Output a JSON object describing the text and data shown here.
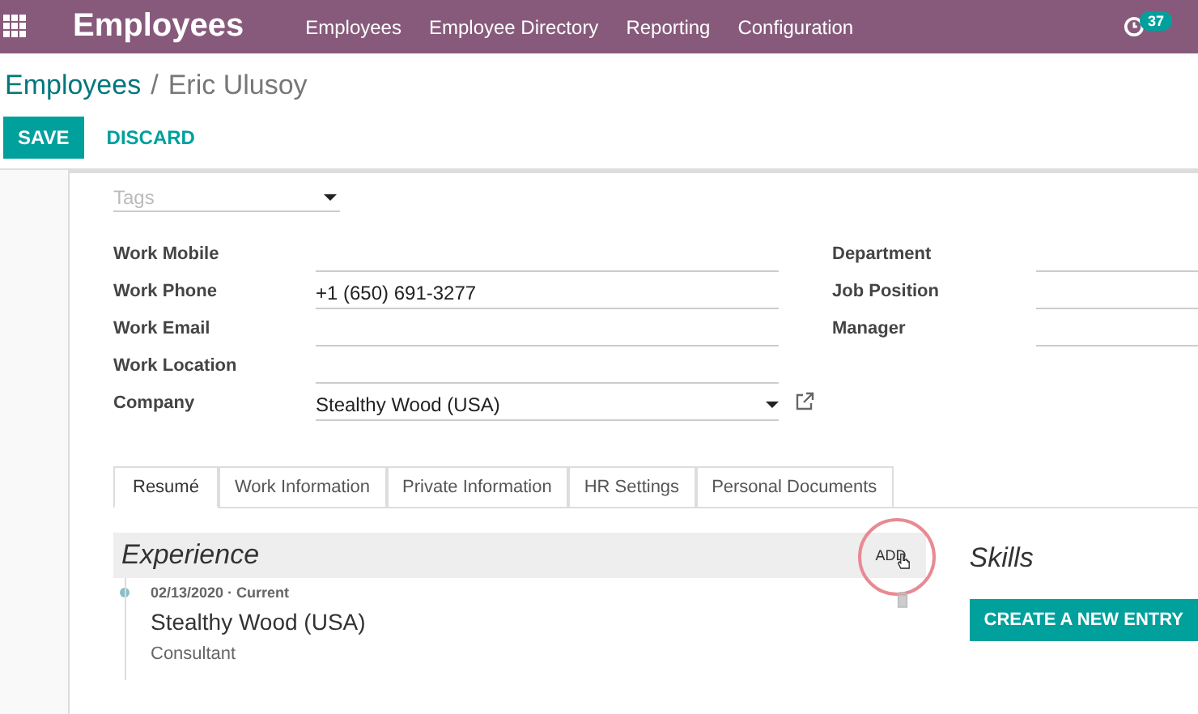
{
  "navbar": {
    "app_title": "Employees",
    "menu": [
      "Employees",
      "Employee Directory",
      "Reporting",
      "Configuration"
    ],
    "activity_count": "37"
  },
  "breadcrumb": {
    "parent": "Employees",
    "separator": "/",
    "current": "Eric Ulusoy"
  },
  "actions": {
    "save": "SAVE",
    "discard": "DISCARD"
  },
  "tags_field": {
    "placeholder": "Tags"
  },
  "left_fields": [
    {
      "label": "Work Mobile",
      "kind": "text"
    },
    {
      "label": "Work Phone",
      "kind": "text",
      "value": "+1 (650) 691-3277"
    },
    {
      "label": "Work Email",
      "kind": "text"
    },
    {
      "label": "Work Location",
      "kind": "text"
    },
    {
      "label": "Company",
      "kind": "select",
      "value": "Stealthy Wood (USA)"
    }
  ],
  "right_fields": [
    {
      "label": "Department"
    },
    {
      "label": "Job Position"
    },
    {
      "label": "Manager"
    }
  ],
  "tabs": [
    {
      "label": "Resumé",
      "selected": true
    },
    {
      "label": "Work Information",
      "selected": false
    },
    {
      "label": "Private Information",
      "selected": false
    },
    {
      "label": "HR Settings",
      "selected": false
    },
    {
      "label": "Personal Documents",
      "selected": false
    }
  ],
  "experience": {
    "title": "Experience",
    "add_label": "ADD",
    "entries": [
      {
        "date": "02/13/2020 · Current",
        "company": "Stealthy Wood (USA)",
        "position": "Consultant"
      }
    ]
  },
  "skills": {
    "title": "Skills",
    "button": "CREATE A NEW ENTRY"
  }
}
